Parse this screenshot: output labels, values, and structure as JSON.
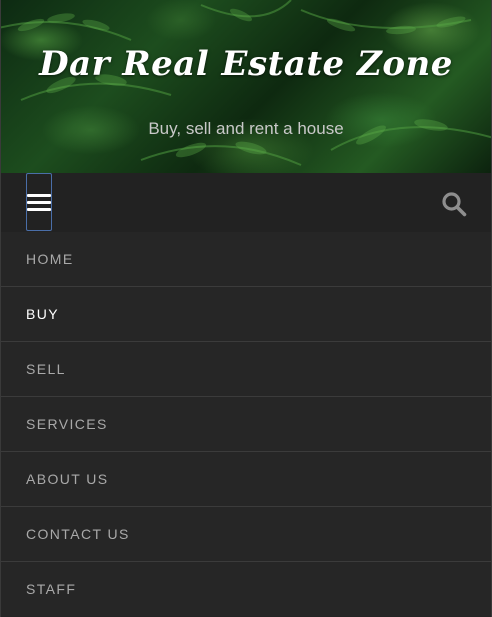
{
  "header": {
    "title": "Dar Real Estate Zone",
    "tagline": "Buy, sell and rent a house"
  },
  "topbar": {
    "menu_icon": "hamburger-menu-icon",
    "search_icon": "search-icon"
  },
  "nav": {
    "items": [
      {
        "label": "HOME",
        "active": false
      },
      {
        "label": "BUY",
        "active": true
      },
      {
        "label": "SELL",
        "active": false
      },
      {
        "label": "SERVICES",
        "active": false
      },
      {
        "label": "ABOUT US",
        "active": false
      },
      {
        "label": "CONTACT US",
        "active": false
      },
      {
        "label": "STAFF",
        "active": false
      }
    ]
  },
  "colors": {
    "nav_background": "#262626",
    "topbar_background": "#222222",
    "nav_text": "#a9a9a9",
    "nav_active_text": "#ffffff",
    "toggle_border": "#4a6ea8"
  }
}
